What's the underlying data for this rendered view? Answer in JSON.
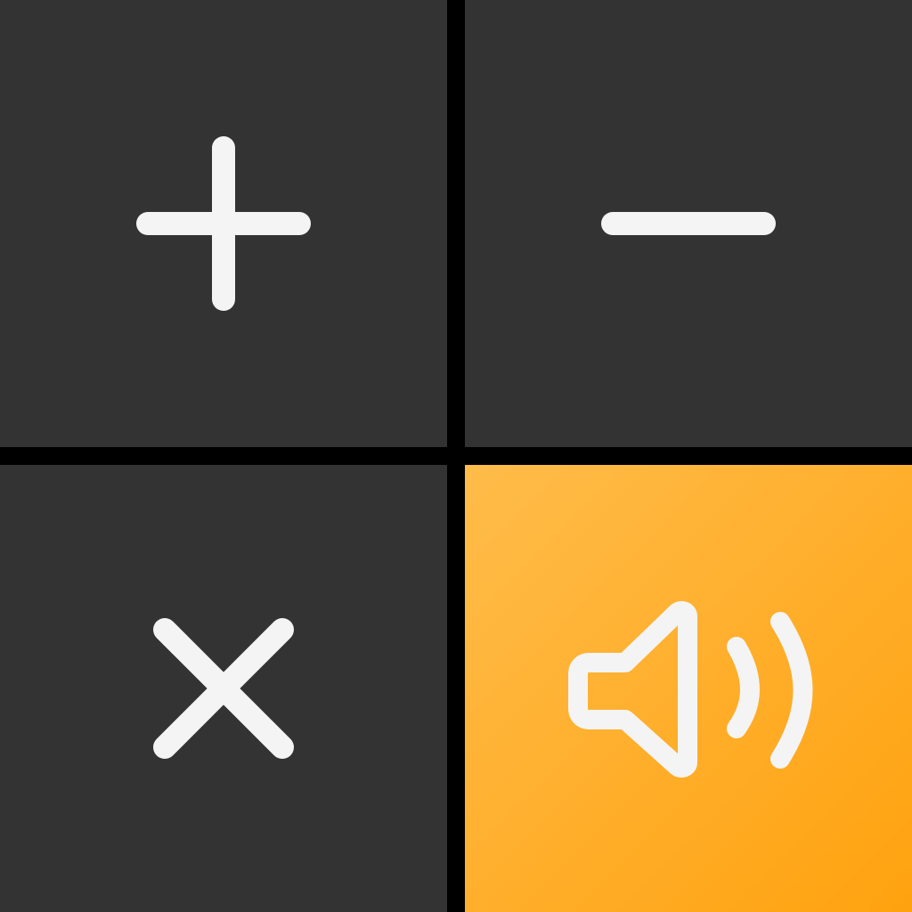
{
  "colors": {
    "background": "#000000",
    "dark_tile": "#333333",
    "glyph": "#F4F4F4",
    "accent_start": "#FFBC4A",
    "accent_end": "#FFA20F"
  },
  "keys": [
    {
      "id": "plus",
      "icon": "plus-icon",
      "glyph": "+"
    },
    {
      "id": "minus",
      "icon": "minus-icon",
      "glyph": "−"
    },
    {
      "id": "multiply",
      "icon": "multiply-icon",
      "glyph": "×"
    },
    {
      "id": "sound",
      "icon": "speaker-volume-icon",
      "glyph": "🔊"
    }
  ]
}
